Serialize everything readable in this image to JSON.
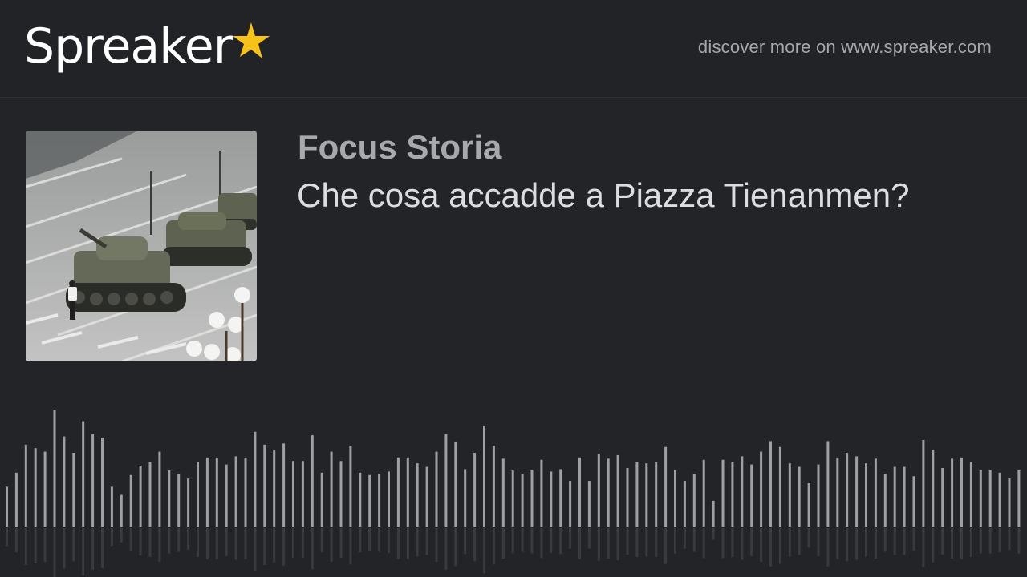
{
  "header": {
    "brand": "Spreaker",
    "brand_icon": "star-icon",
    "star_color": "#f7c21a",
    "discover_text": "discover more on www.spreaker.com"
  },
  "podcast": {
    "show_title": "Focus Storia",
    "episode_title": "Che cosa accadde a Piazza Tienanmen?",
    "cover_description": "cover-image"
  },
  "waveform": {
    "bar_color": "#9fa0a4",
    "levels": [
      0.34,
      0.46,
      0.7,
      0.67,
      0.64,
      1.0,
      0.77,
      0.63,
      0.9,
      0.79,
      0.76,
      0.34,
      0.27,
      0.44,
      0.52,
      0.55,
      0.64,
      0.48,
      0.45,
      0.41,
      0.55,
      0.59,
      0.59,
      0.53,
      0.6,
      0.59,
      0.81,
      0.7,
      0.65,
      0.71,
      0.56,
      0.56,
      0.78,
      0.46,
      0.64,
      0.56,
      0.69,
      0.46,
      0.44,
      0.45,
      0.47,
      0.59,
      0.59,
      0.54,
      0.51,
      0.64,
      0.79,
      0.72,
      0.49,
      0.63,
      0.86,
      0.69,
      0.58,
      0.48,
      0.45,
      0.48,
      0.57,
      0.47,
      0.49,
      0.39,
      0.59,
      0.39,
      0.62,
      0.58,
      0.61,
      0.5,
      0.55,
      0.54,
      0.55,
      0.68,
      0.48,
      0.39,
      0.45,
      0.57,
      0.22,
      0.57,
      0.55,
      0.6,
      0.53,
      0.64,
      0.73,
      0.68,
      0.54,
      0.51,
      0.37,
      0.53,
      0.73,
      0.59,
      0.63,
      0.6,
      0.54,
      0.58,
      0.45,
      0.51,
      0.51,
      0.43,
      0.74,
      0.65,
      0.5,
      0.58,
      0.59,
      0.55,
      0.48,
      0.48,
      0.46,
      0.41,
      0.48,
      0.52,
      0.07
    ]
  }
}
